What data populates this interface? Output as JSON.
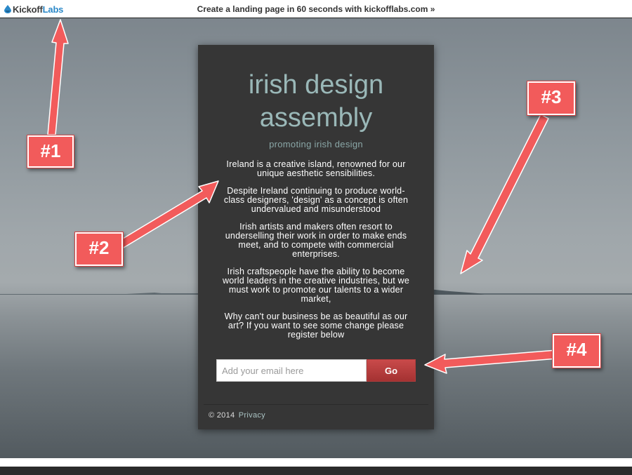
{
  "topbar": {
    "logo_kickoff": "Kickoff",
    "logo_labs": "Labs",
    "promo": "Create a landing page in 60 seconds with kickofflabs.com »"
  },
  "card": {
    "title_line1": "irish design",
    "title_line2": "assembly",
    "tagline": "promoting irish design",
    "paragraphs": [
      "Ireland is a creative island, renowned for our unique aesthetic sensibilities.",
      "Despite Ireland continuing to produce world-class designers, 'design' as a concept is often undervalued and misunderstood",
      "Irish artists and makers often resort to underselling their work in order to make ends meet, and to compete with commercial enterprises.",
      "Irish craftspeople have the ability to become world leaders in the creative industries, but we must work to promote our talents to a wider market,",
      "Why can't our business be as beautiful as our art? If you want to see some change please register below"
    ],
    "email_placeholder": "Add your email here",
    "email_value": "",
    "go_label": "Go",
    "footer_copyright": "© 2014",
    "footer_privacy": "Privacy"
  },
  "annotations": {
    "badge1": "#1",
    "badge2": "#2",
    "badge3": "#3",
    "badge4": "#4"
  },
  "colors": {
    "accent_red": "#f25b5b",
    "title_teal": "#9ab8b8",
    "card_bg": "#363636",
    "go_button": "#b83c3c",
    "logo_blue": "#2a88c8"
  }
}
